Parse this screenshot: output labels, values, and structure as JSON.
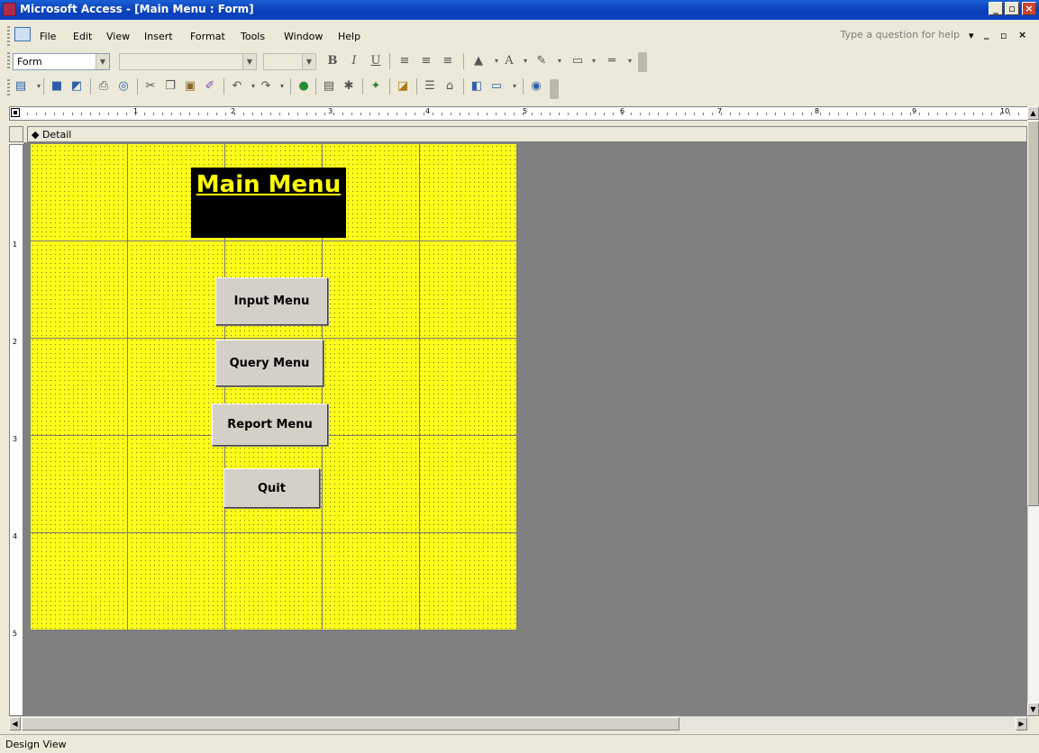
{
  "window": {
    "title": "Microsoft Access - [Main Menu : Form]",
    "controls": [
      "_",
      "▫",
      "×"
    ]
  },
  "menubar": {
    "items": [
      "File",
      "Edit",
      "View",
      "Insert",
      "Format",
      "Tools",
      "Window",
      "Help"
    ],
    "help_placeholder": "Type a question for help",
    "doc_controls": [
      "▾",
      "_",
      "▫",
      "×"
    ]
  },
  "formatting": {
    "object_combo": "Form",
    "font_combo": "",
    "size_combo": "",
    "bold": "B",
    "italic": "I",
    "underline": "U",
    "font_color": "A"
  },
  "ruler": {
    "marks": [
      "1",
      "2",
      "3",
      "4",
      "5",
      "6",
      "7",
      "8",
      "9",
      "10"
    ],
    "vmarks": [
      "1",
      "2",
      "3",
      "4",
      "5"
    ]
  },
  "section": {
    "label": "◆ Detail"
  },
  "form": {
    "back_color": "#ffff1a",
    "title": "Main Menu",
    "buttons": {
      "input": "Input Menu",
      "query": "Query Menu",
      "report": "Report Menu",
      "quit": "Quit"
    }
  },
  "status": {
    "text": "Design View"
  }
}
